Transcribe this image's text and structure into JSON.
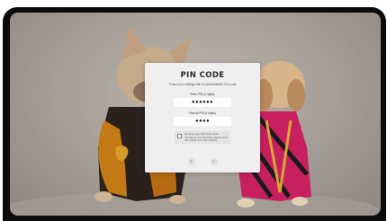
{
  "pin_dialog": {
    "title": "PIN CODE",
    "subtitle": "Protect your settings with an administrative PIN code",
    "pin_label": "Enter PIN (4 digits)",
    "pin_value": "●●●●●●",
    "repeat_label": "Repeat PIN (4 digits)",
    "repeat_value": "●●●●",
    "checkbox_label": "Require your PIN code while managing and adjusting alarms and the screen from the display",
    "checkbox_checked": false,
    "prev_icon": "chevron-left-icon",
    "next_icon": "chevron-right-icon",
    "prev_glyph": "‹",
    "next_glyph": "›"
  },
  "colors": {
    "bezel": "#0b0b0b",
    "modal_bg": "#efefef",
    "title": "#2b2b2b"
  }
}
